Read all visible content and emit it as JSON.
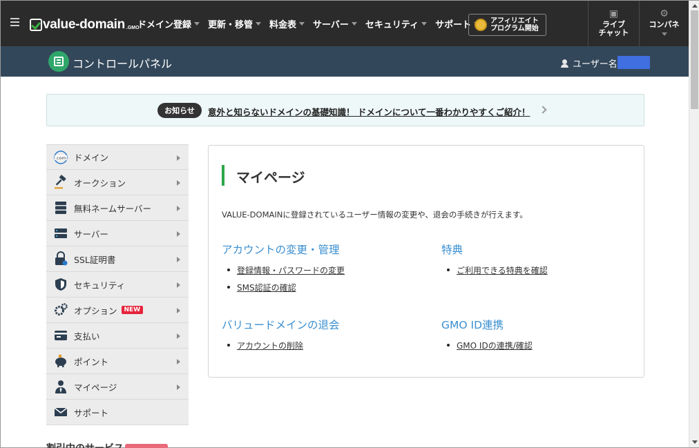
{
  "header": {
    "logo_text": "value-domain",
    "logo_sub": ".GMO",
    "nav": [
      {
        "label": "ドメイン登録"
      },
      {
        "label": "更新・移管"
      },
      {
        "label": "料金表"
      },
      {
        "label": "サーバー"
      },
      {
        "label": "セキュリティ"
      },
      {
        "label": "サポート"
      }
    ],
    "affiliate": {
      "line1": "アフィリエイト",
      "line2": "プログラム開始"
    },
    "livechat": {
      "line1": "ライブ",
      "line2": "チャット"
    },
    "control": {
      "label": "コンパネ"
    }
  },
  "subheader": {
    "title": "コントロールパネル",
    "user_label": "ユーザー名"
  },
  "notice": {
    "badge": "お知らせ",
    "text": "意外と知らないドメインの基礎知識！ ドメインについて一番わかりやすくご紹介！"
  },
  "sidebar": {
    "items": [
      {
        "label": "ドメイン",
        "icon": "globe-com-icon"
      },
      {
        "label": "オークション",
        "icon": "gavel-icon"
      },
      {
        "label": "無料ネームサーバー",
        "icon": "server-stack-icon"
      },
      {
        "label": "サーバー",
        "icon": "server-icon"
      },
      {
        "label": "SSL証明書",
        "icon": "lock-icon"
      },
      {
        "label": "セキュリティ",
        "icon": "shield-icon"
      },
      {
        "label": "オプション",
        "icon": "gears-icon",
        "badge": "NEW"
      },
      {
        "label": "支払い",
        "icon": "credit-card-icon"
      },
      {
        "label": "ポイント",
        "icon": "piggy-bank-icon"
      },
      {
        "label": "マイページ",
        "icon": "user-tie-icon"
      },
      {
        "label": "サポート",
        "icon": "mail-icon"
      }
    ],
    "partial_label": "割引中のサービス"
  },
  "main": {
    "title": "マイページ",
    "description": "VALUE-DOMAINに登録されているユーザー情報の変更や、退会の手続きが行えます。",
    "sections": [
      {
        "title": "アカウントの変更・管理",
        "links": [
          "登録情報・パスワードの変更",
          "SMS認証の確認"
        ]
      },
      {
        "title": "特典",
        "links": [
          "ご利用できる特典を確認"
        ]
      },
      {
        "title": "バリュードメインの退会",
        "links": [
          "アカウントの削除"
        ]
      },
      {
        "title": "GMO ID連携",
        "links": [
          "GMO IDの連携/確認"
        ]
      }
    ]
  },
  "colors": {
    "topbar": "#2b2b2b",
    "subbar": "#33475a",
    "accent_green": "#2fa64a",
    "link_blue": "#3a8fd1",
    "new_badge": "#e5243b"
  }
}
